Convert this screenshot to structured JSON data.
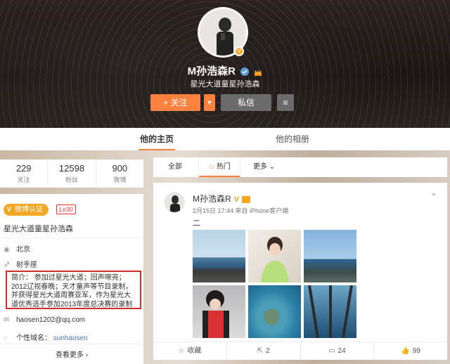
{
  "header": {
    "name": "M孙浩森R",
    "subtitle": "星光大道童星孙浩森",
    "follow_label": "+ 关注",
    "more_label": "▼",
    "message_label": "私信",
    "menu_label": "≡",
    "verified_icon": "v-badge-icon",
    "accent": "#ff8140"
  },
  "tabs": {
    "home": "他的主页",
    "album": "他的相册"
  },
  "stats": [
    {
      "value": "229",
      "label": "关注"
    },
    {
      "value": "12598",
      "label": "粉丝"
    },
    {
      "value": "900",
      "label": "微博"
    }
  ],
  "profile": {
    "verified_label": "微博认证",
    "level_label": "Lv30",
    "verified_desc": "星光大道童星孙浩森",
    "location": "北京",
    "zodiac": "射手座",
    "bio": "简介： 参加过星光大道；回声嘹亮；2012辽视春晚；天才童声等节目录制，并获得星光大道周赛亚军，作为星光大道优秀选手参加2013年度总决赛的录制",
    "email": "haosen1202@qq.com",
    "domain_label": "个性域名：",
    "domain_value": "sunhaosen",
    "see_all": "查看更多 ›"
  },
  "feed_tabs": {
    "all": "全部",
    "hot": "热门",
    "more": "更多 ⌄"
  },
  "post": {
    "author": "M孙浩森R",
    "v_mark": "V",
    "meta": "2月15日 17:44 来自 iPhone客户端",
    "text": "二",
    "chevron": "⌄",
    "actions": {
      "favorite": "收藏",
      "repost": "2",
      "comment": "24",
      "like": "99"
    }
  }
}
